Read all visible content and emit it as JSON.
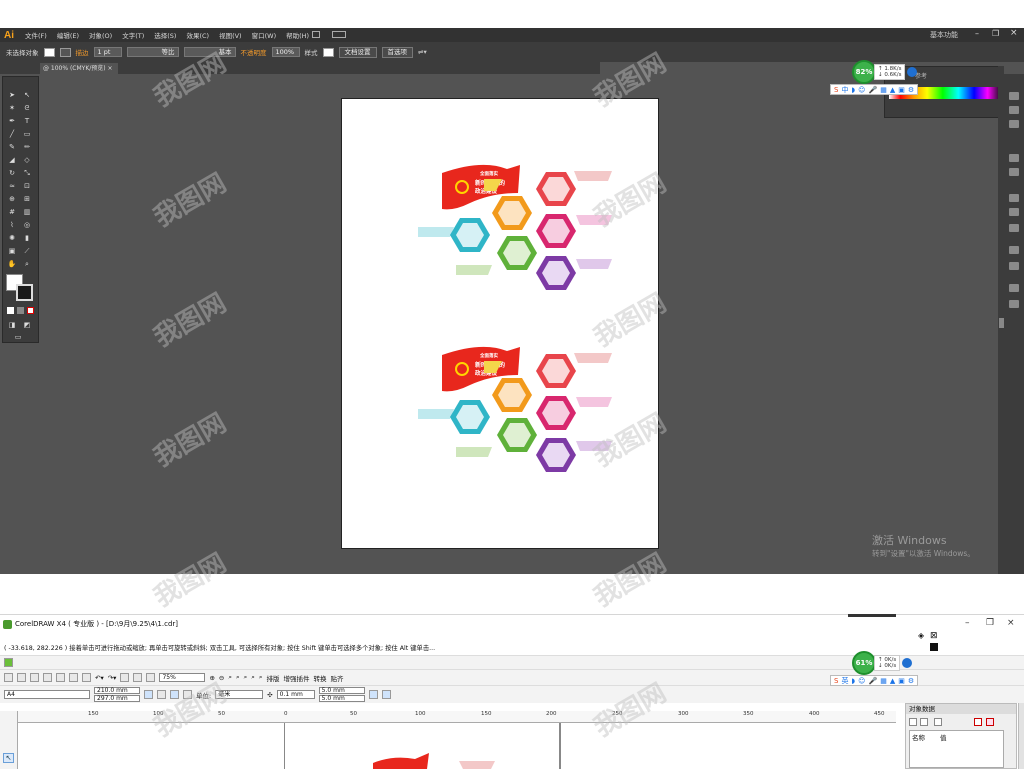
{
  "ai": {
    "logo": "Ai",
    "menus": [
      "文件(F)",
      "编辑(E)",
      "对象(O)",
      "文字(T)",
      "选择(S)",
      "效果(C)",
      "视图(V)",
      "窗口(W)",
      "帮助(H)"
    ],
    "workspace": "基本功能",
    "control": {
      "selection": "未选择对象",
      "stroke_label": "描边",
      "stroke_value": "1 pt",
      "line_style": "等比",
      "brush": "基本",
      "opacity_label": "不透明度",
      "opacity_value": "100%",
      "style_label": "样式",
      "doc_setup": "文档设置",
      "prefs": "首选项"
    },
    "doc_tab": "@ 100% (CMYK/预览)",
    "color_panel_title": "参考",
    "network": {
      "percent": "82%",
      "up": "1.8K/s",
      "down": "0.6K/s"
    },
    "ime": {
      "label": "中"
    },
    "activation": {
      "line1": "激活 Windows",
      "line2": "转到\"设置\"以激活 Windows。"
    }
  },
  "cdr": {
    "title": "CorelDRAW X4 ( 专业版 ) - [D:\\9月\\9.25\\4\\1.cdr]",
    "status": "( -33.618, 282.226 )     接着单击可进行拖动或缩放; 再单击可旋转或斜斜; 双击工具, 可选择所有对象; 按住 Shift 键单击可选择多个对象; 按住 Alt 键单击...",
    "toolbar": {
      "zoom": "75%",
      "arrange": "排版",
      "bitmap": "增强插件",
      "convert": "转换",
      "paste": "贴齐"
    },
    "props": {
      "page_size": "A4",
      "width": "210.0 mm",
      "height": "297.0 mm",
      "unit_label": "单位:",
      "unit": "毫米",
      "nudge": "0.1 mm",
      "dup_x": "5.0 mm",
      "dup_y": "5.0 mm"
    },
    "ruler_marks": [
      "150",
      "100",
      "50",
      "0",
      "50",
      "100",
      "150",
      "200",
      "250",
      "300",
      "350",
      "400",
      "450"
    ],
    "docker": {
      "title": "对象数据",
      "col_name": "名称",
      "col_value": "值"
    },
    "network": {
      "percent": "61%",
      "up": "0K/s",
      "down": "0K/s"
    },
    "ime": {
      "label": "英"
    }
  },
  "design": {
    "banner_line1": "全面落实",
    "banner_line2": "新时代党的",
    "banner_line3": "政治建设"
  },
  "watermark": "我图网"
}
